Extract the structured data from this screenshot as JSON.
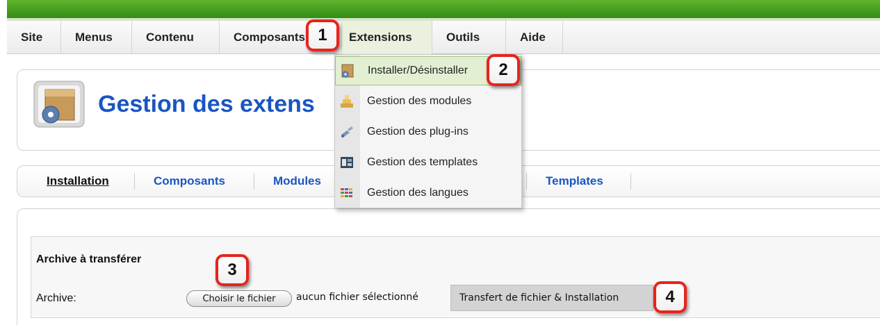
{
  "menu": {
    "items": [
      {
        "label": "Site"
      },
      {
        "label": "Menus"
      },
      {
        "label": "Contenu"
      },
      {
        "label": "Composants"
      },
      {
        "label": "Extensions"
      },
      {
        "label": "Outils"
      },
      {
        "label": "Aide"
      }
    ],
    "active": "Extensions"
  },
  "dropdown": {
    "items": [
      {
        "label": "Installer/Désinstaller",
        "icon": "installer-icon"
      },
      {
        "label": "Gestion des modules",
        "icon": "modules-icon"
      },
      {
        "label": "Gestion des plug-ins",
        "icon": "plugins-icon"
      },
      {
        "label": "Gestion des templates",
        "icon": "templates-icon"
      },
      {
        "label": "Gestion des langues",
        "icon": "languages-icon"
      }
    ]
  },
  "header": {
    "title": "Gestion des extens"
  },
  "tabs": [
    {
      "label": "Installation"
    },
    {
      "label": "Composants"
    },
    {
      "label": "Modules"
    },
    {
      "label": "Templates"
    }
  ],
  "upload": {
    "section_title": "Archive à transférer",
    "archive_label": "Archive:",
    "file_button": "Choisir le fichier",
    "file_status": "aucun fichier sélectionné",
    "submit_button": "Transfert de fichier & Installation"
  },
  "callouts": [
    "1",
    "2",
    "3",
    "4"
  ],
  "colors": {
    "accent_green": "#2f8a12",
    "title_blue": "#1a55c3",
    "callout_red": "#e8231d"
  }
}
